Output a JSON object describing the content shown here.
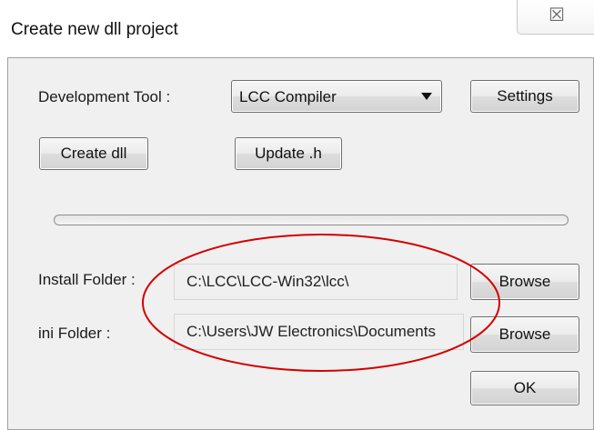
{
  "window": {
    "title": "Create new dll project",
    "close_glyph": "☒",
    "close_icon": "close-icon"
  },
  "dev_tool": {
    "label": "Development Tool :",
    "selected": "LCC Compiler",
    "settings_label": "Settings"
  },
  "actions": {
    "create_dll_label": "Create dll",
    "update_h_label": "Update .h"
  },
  "progress": {
    "value": 0
  },
  "install": {
    "label": "Install Folder :",
    "value": "C:\\LCC\\LCC-Win32\\lcc\\",
    "browse_label": "Browse"
  },
  "ini": {
    "label": "ini Folder :",
    "value": "C:\\Users\\JW Electronics\\Documents",
    "browse_label": "Browse"
  },
  "ok_label": "OK",
  "colors": {
    "annotation_ellipse": "#d40000",
    "panel_bg": "#f0f0f0"
  }
}
